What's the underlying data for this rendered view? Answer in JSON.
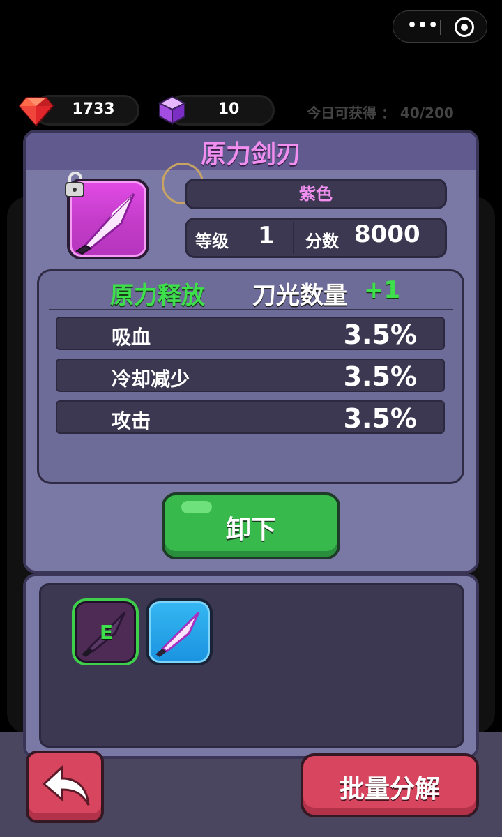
{
  "capsule": {
    "menu_icon": "more-dots-icon",
    "close_icon": "target-circle-icon"
  },
  "resources": {
    "gems": {
      "icon": "red-gem-icon",
      "value": "1733"
    },
    "cubes": {
      "icon": "purple-cube-icon",
      "value": "10"
    },
    "daily_limit": "今日可获得 ： 40/200"
  },
  "item": {
    "title": "原力剑刃",
    "rarity": "紫色",
    "level_label": "等级",
    "level_value": "1",
    "score_label": "分数",
    "score_value": "8000",
    "lock_icon": "unlocked-padlock-icon",
    "icon": "purple-blade-icon"
  },
  "ability": {
    "name": "原力释放",
    "effect": "刀光数量",
    "effect_bonus": "+1"
  },
  "attributes": [
    {
      "name": "吸血",
      "value": "3.5%"
    },
    {
      "name": "冷却减少",
      "value": "3.5%"
    },
    {
      "name": "攻击",
      "value": "3.5%"
    }
  ],
  "actions": {
    "unequip": "卸下",
    "batch_decompose": "批量分解",
    "back_icon": "back-arrow-icon"
  },
  "inventory": [
    {
      "badge": "E",
      "icon": "dark-blade-icon",
      "equipped": true
    },
    {
      "badge": "",
      "icon": "blue-blade-icon",
      "equipped": false
    }
  ],
  "colors": {
    "purple_title": "#f08ff0",
    "green": "#3ddf4a",
    "button_green": "#37b94c",
    "button_red": "#d8455e"
  }
}
